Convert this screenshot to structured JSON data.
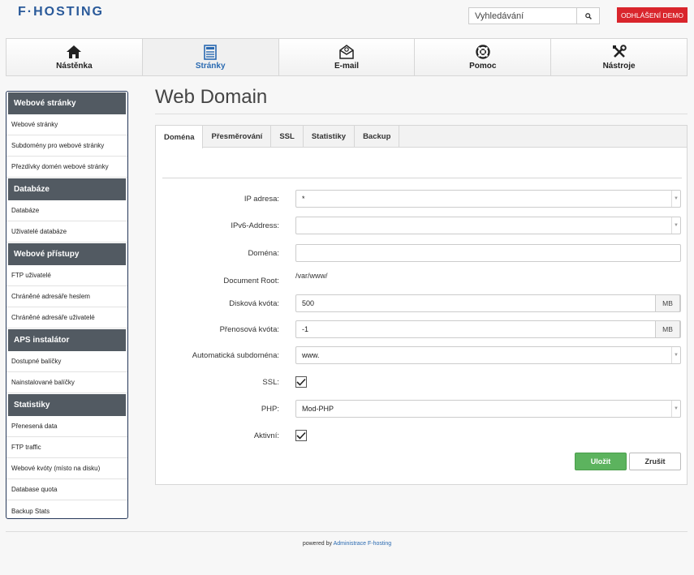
{
  "header": {
    "logo": "F·HOSTING",
    "search_placeholder": "Vyhledávání",
    "logout_label": "ODHLÁŠENÍ DEMO"
  },
  "topnav": [
    {
      "label": "Nástěnka",
      "icon": "home-icon"
    },
    {
      "label": "Stránky",
      "icon": "page-icon"
    },
    {
      "label": "E-mail",
      "icon": "envelope-icon"
    },
    {
      "label": "Pomoc",
      "icon": "lifebuoy-icon"
    },
    {
      "label": "Nástroje",
      "icon": "tools-icon"
    }
  ],
  "sidebar": [
    {
      "header": "Webové stránky",
      "items": [
        "Webové stránky",
        "Subdomény pro webové stránky",
        "Přezdívky domén webové stránky"
      ]
    },
    {
      "header": "Databáze",
      "items": [
        "Databáze",
        "Uživatelé databáze"
      ]
    },
    {
      "header": "Webové přístupy",
      "items": [
        "FTP uživatelé",
        "Chráněné adresáře heslem",
        "Chráněné adresáře uživatelé"
      ]
    },
    {
      "header": "APS instalátor",
      "items": [
        "Dostupné balíčky",
        "Nainstalované balíčky"
      ]
    },
    {
      "header": "Statistiky",
      "items": [
        "Přenesená data",
        "FTP traffic",
        "Webové kvóty (místo na disku)",
        "Database quota",
        "Backup Stats"
      ]
    }
  ],
  "page": {
    "title": "Web Domain"
  },
  "tabs": [
    "Doména",
    "Přesměrování",
    "SSL",
    "Statistiky",
    "Backup"
  ],
  "form": {
    "ip_label": "IP adresa:",
    "ip_value": "*",
    "ipv6_label": "IPv6-Address:",
    "ipv6_value": "",
    "domain_label": "Doména:",
    "domain_value": "",
    "docroot_label": "Document Root:",
    "docroot_value": "/var/www/",
    "disk_label": "Disková kvóta:",
    "disk_value": "500",
    "disk_unit": "MB",
    "traffic_label": "Přenosová kvóta:",
    "traffic_value": "-1",
    "traffic_unit": "MB",
    "autosub_label": "Automatická subdoména:",
    "autosub_value": "www.",
    "ssl_label": "SSL:",
    "ssl_checked": true,
    "php_label": "PHP:",
    "php_value": "Mod-PHP",
    "active_label": "Aktivní:",
    "active_checked": true,
    "save_label": "Uložit",
    "cancel_label": "Zrušit"
  },
  "footer": {
    "prefix": "powered by",
    "link": "Administrace F-hosting"
  },
  "colors": {
    "accent": "#2a6ab1",
    "logout": "#d9252c",
    "save": "#5cb35e",
    "sidebar_header": "#525a62"
  }
}
